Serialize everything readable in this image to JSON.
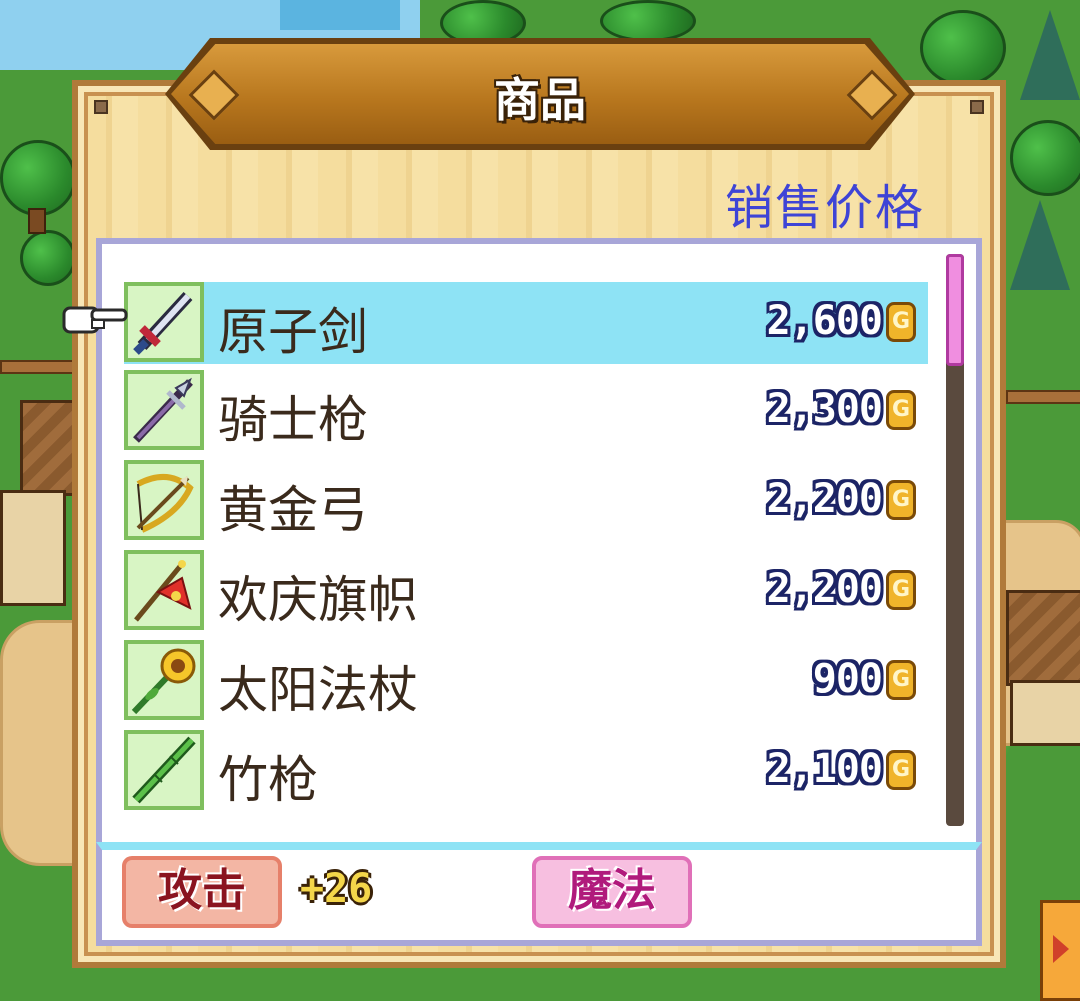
{
  "shop": {
    "title": "商品",
    "price_header": "销售价格",
    "currency_symbol": "G",
    "selected_index": 0,
    "items": [
      {
        "name": "原子剑",
        "price": "2,600",
        "icon": "sword-icon"
      },
      {
        "name": "骑士枪",
        "price": "2,300",
        "icon": "lance-icon"
      },
      {
        "name": "黄金弓",
        "price": "2,200",
        "icon": "bow-icon"
      },
      {
        "name": "欢庆旗帜",
        "price": "2,200",
        "icon": "flag-icon"
      },
      {
        "name": "太阳法杖",
        "price": "900",
        "icon": "sunflower-staff-icon"
      },
      {
        "name": "竹枪",
        "price": "2,100",
        "icon": "bamboo-spear-icon"
      }
    ]
  },
  "stats": {
    "attack_label": "攻击",
    "attack_value": "+26",
    "magic_label": "魔法"
  },
  "colors": {
    "selected_row": "#8ee3f5",
    "price_header": "#3e44d6",
    "scroll_thumb": "#f08ee0"
  },
  "scroll": {
    "position": 0
  }
}
